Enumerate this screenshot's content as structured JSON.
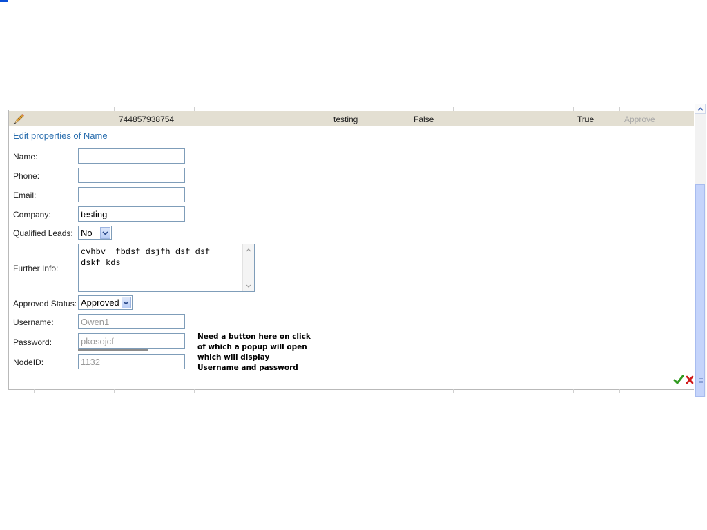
{
  "data_row": {
    "id": "744857938754",
    "company": "testing",
    "col_false": "False",
    "col_true": "True",
    "approve": "Approve"
  },
  "form": {
    "title": "Edit properties of Name",
    "name_label": "Name:",
    "name_value": "",
    "phone_label": "Phone:",
    "phone_value": "",
    "email_label": "Email:",
    "email_value": "",
    "company_label": "Company:",
    "company_value": "testing",
    "qualified_label": "Qualified Leads:",
    "qualified_value": "No",
    "further_label": "Further Info:",
    "further_value": "cvhbv  fbdsf dsjfh dsf dsf\ndskf kds",
    "approved_label": "Approved Status:",
    "approved_value": "Approved",
    "username_label": "Username:",
    "username_value": "Owen1",
    "password_label": "Password:",
    "password_value": "pkosojcf",
    "nodeid_label": "NodeID:",
    "nodeid_value": "1132"
  },
  "note": "Need a button here on click\nof which a popup will open\nwhich will display\nUsername and password",
  "icons": {
    "edit": "pencil-icon",
    "save": "checkmark-icon",
    "cancel": "close-icon"
  },
  "colors": {
    "row_bg": "#e3dfd2",
    "title": "#2a6eae",
    "input_border": "#7f9db9",
    "save": "#2f9a1f",
    "cancel": "#d01818"
  }
}
